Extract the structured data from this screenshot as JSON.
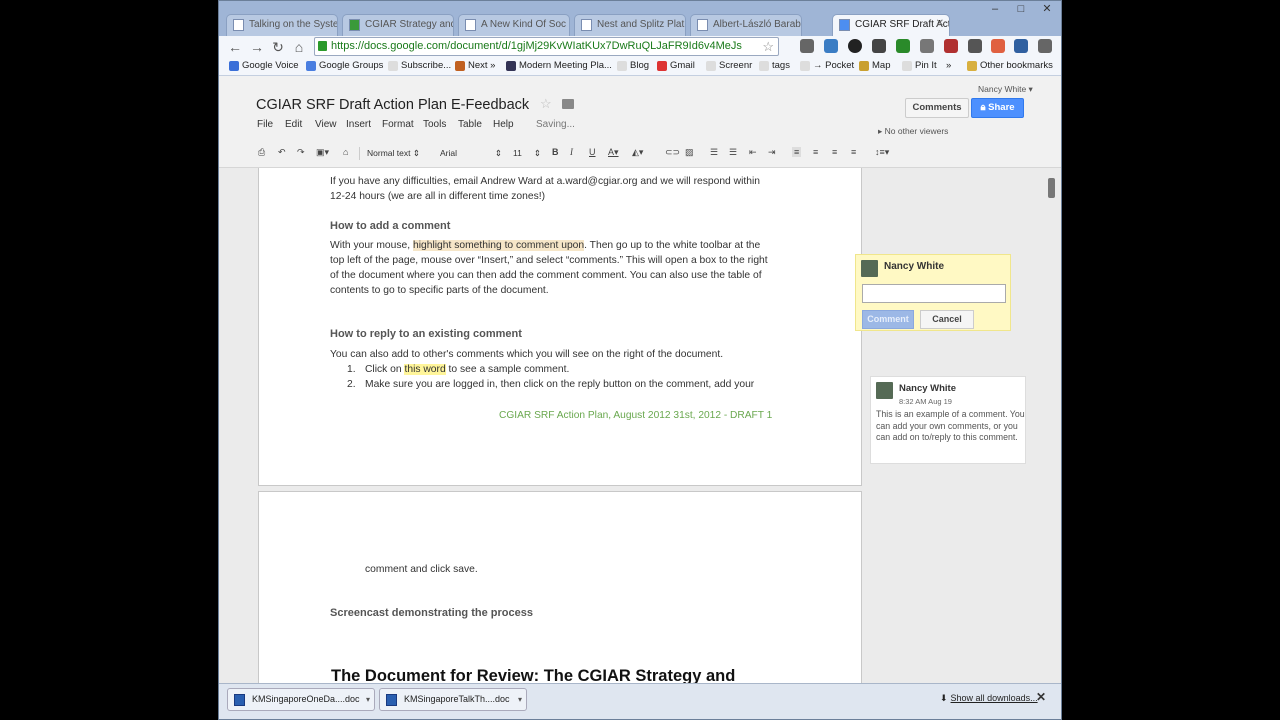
{
  "browser": {
    "tabs": [
      {
        "label": "Talking on the Syste"
      },
      {
        "label": "CGIAR Strategy and"
      },
      {
        "label": "A New Kind Of Soc"
      },
      {
        "label": "Nest and Splitz Plat"
      },
      {
        "label": "Albert-László Barab"
      },
      {
        "label": "CGIAR SRF Draft Actio",
        "active": true
      }
    ],
    "url": "https://docs.google.com/document/d/1gjMj29KvWIatKUx7DwRuQLJaFR9Id6v4MeJs",
    "window_controls": [
      "–",
      "□",
      "✕"
    ],
    "bookmarks": [
      "Google Voice",
      "Google Groups",
      "Subscribe...",
      "Next »",
      "Modern Meeting Pla...",
      "Blog",
      "Gmail",
      "Screenr",
      "tags",
      "→ Pocket",
      "Map",
      "Pin It",
      "»",
      "Other bookmarks"
    ]
  },
  "docs": {
    "title": "CGIAR SRF Draft Action Plan E-Feedback",
    "menu": [
      "File",
      "Edit",
      "View",
      "Insert",
      "Format",
      "Tools",
      "Table",
      "Help"
    ],
    "status": "Saving...",
    "user": "Nancy White ▾",
    "comments_btn": "Comments",
    "share_btn": "Share",
    "viewers": "No other viewers",
    "toolbar": {
      "style": "Normal text",
      "font": "Arial",
      "size": "11"
    }
  },
  "content": {
    "para1_line1": "If you have any difficulties, email Andrew Ward at a.ward@cgiar.org and we will respond within",
    "para1_line2": "12-24 hours (we are all in different time zones!)",
    "heading_add": "How to add a comment",
    "add_l1_pre": "With your mouse, ",
    "add_l1_hl": "highlight something to comment upon",
    "add_l1_post": ". Then go up to the white toolbar at the",
    "add_l2": "top left of the page, mouse over “Insert,” and select “comments.” This will open a box to the right",
    "add_l3": "of the document where you can then add the comment comment. You can also use the table of",
    "add_l4": "contents to go to specific parts of the document.",
    "heading_reply": "How to reply to an existing comment",
    "reply_intro": "You can also add to other's comments which you will see on the right of the document.",
    "item1_num": "1.",
    "item1_pre": "Click on ",
    "item1_hl": "this word",
    "item1_post": " to see a sample comment.",
    "item2_num": "2.",
    "item2": "Make sure you are logged in, then click on the reply button on the comment, add your",
    "footer": "CGIAR SRF Action Plan, August 2012  31st, 2012 - DRAFT 1",
    "p2_cont": "comment and click save.",
    "screencast": "Screencast demonstrating the process",
    "big_heading": "The Document for Review: The CGIAR Strategy and"
  },
  "comment_new": {
    "author": "Nancy White",
    "comment_btn": "Comment",
    "cancel_btn": "Cancel"
  },
  "comment_existing": {
    "author": "Nancy White",
    "time": "8:32 AM Aug 19",
    "body": "This is an example of a comment. You can add your own comments, or you can add on to/reply to this comment."
  },
  "downloads": {
    "items": [
      "KMSingaporeOneDa....doc",
      "KMSingaporeTalkTh....doc"
    ],
    "show_all": "Show all downloads..."
  }
}
